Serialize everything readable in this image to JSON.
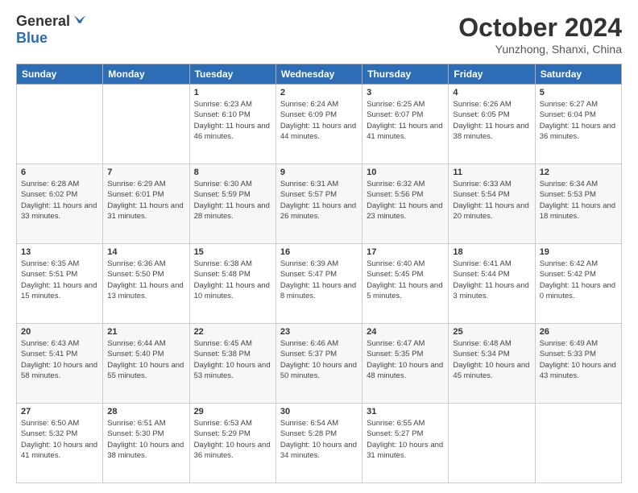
{
  "logo": {
    "general": "General",
    "blue": "Blue"
  },
  "header": {
    "title": "October 2024",
    "subtitle": "Yunzhong, Shanxi, China"
  },
  "weekdays": [
    "Sunday",
    "Monday",
    "Tuesday",
    "Wednesday",
    "Thursday",
    "Friday",
    "Saturday"
  ],
  "weeks": [
    [
      null,
      null,
      {
        "day": 1,
        "sunrise": "6:23 AM",
        "sunset": "6:10 PM",
        "daylight": "11 hours and 46 minutes."
      },
      {
        "day": 2,
        "sunrise": "6:24 AM",
        "sunset": "6:09 PM",
        "daylight": "11 hours and 44 minutes."
      },
      {
        "day": 3,
        "sunrise": "6:25 AM",
        "sunset": "6:07 PM",
        "daylight": "11 hours and 41 minutes."
      },
      {
        "day": 4,
        "sunrise": "6:26 AM",
        "sunset": "6:05 PM",
        "daylight": "11 hours and 38 minutes."
      },
      {
        "day": 5,
        "sunrise": "6:27 AM",
        "sunset": "6:04 PM",
        "daylight": "11 hours and 36 minutes."
      }
    ],
    [
      {
        "day": 6,
        "sunrise": "6:28 AM",
        "sunset": "6:02 PM",
        "daylight": "11 hours and 33 minutes."
      },
      {
        "day": 7,
        "sunrise": "6:29 AM",
        "sunset": "6:01 PM",
        "daylight": "11 hours and 31 minutes."
      },
      {
        "day": 8,
        "sunrise": "6:30 AM",
        "sunset": "5:59 PM",
        "daylight": "11 hours and 28 minutes."
      },
      {
        "day": 9,
        "sunrise": "6:31 AM",
        "sunset": "5:57 PM",
        "daylight": "11 hours and 26 minutes."
      },
      {
        "day": 10,
        "sunrise": "6:32 AM",
        "sunset": "5:56 PM",
        "daylight": "11 hours and 23 minutes."
      },
      {
        "day": 11,
        "sunrise": "6:33 AM",
        "sunset": "5:54 PM",
        "daylight": "11 hours and 20 minutes."
      },
      {
        "day": 12,
        "sunrise": "6:34 AM",
        "sunset": "5:53 PM",
        "daylight": "11 hours and 18 minutes."
      }
    ],
    [
      {
        "day": 13,
        "sunrise": "6:35 AM",
        "sunset": "5:51 PM",
        "daylight": "11 hours and 15 minutes."
      },
      {
        "day": 14,
        "sunrise": "6:36 AM",
        "sunset": "5:50 PM",
        "daylight": "11 hours and 13 minutes."
      },
      {
        "day": 15,
        "sunrise": "6:38 AM",
        "sunset": "5:48 PM",
        "daylight": "11 hours and 10 minutes."
      },
      {
        "day": 16,
        "sunrise": "6:39 AM",
        "sunset": "5:47 PM",
        "daylight": "11 hours and 8 minutes."
      },
      {
        "day": 17,
        "sunrise": "6:40 AM",
        "sunset": "5:45 PM",
        "daylight": "11 hours and 5 minutes."
      },
      {
        "day": 18,
        "sunrise": "6:41 AM",
        "sunset": "5:44 PM",
        "daylight": "11 hours and 3 minutes."
      },
      {
        "day": 19,
        "sunrise": "6:42 AM",
        "sunset": "5:42 PM",
        "daylight": "11 hours and 0 minutes."
      }
    ],
    [
      {
        "day": 20,
        "sunrise": "6:43 AM",
        "sunset": "5:41 PM",
        "daylight": "10 hours and 58 minutes."
      },
      {
        "day": 21,
        "sunrise": "6:44 AM",
        "sunset": "5:40 PM",
        "daylight": "10 hours and 55 minutes."
      },
      {
        "day": 22,
        "sunrise": "6:45 AM",
        "sunset": "5:38 PM",
        "daylight": "10 hours and 53 minutes."
      },
      {
        "day": 23,
        "sunrise": "6:46 AM",
        "sunset": "5:37 PM",
        "daylight": "10 hours and 50 minutes."
      },
      {
        "day": 24,
        "sunrise": "6:47 AM",
        "sunset": "5:35 PM",
        "daylight": "10 hours and 48 minutes."
      },
      {
        "day": 25,
        "sunrise": "6:48 AM",
        "sunset": "5:34 PM",
        "daylight": "10 hours and 45 minutes."
      },
      {
        "day": 26,
        "sunrise": "6:49 AM",
        "sunset": "5:33 PM",
        "daylight": "10 hours and 43 minutes."
      }
    ],
    [
      {
        "day": 27,
        "sunrise": "6:50 AM",
        "sunset": "5:32 PM",
        "daylight": "10 hours and 41 minutes."
      },
      {
        "day": 28,
        "sunrise": "6:51 AM",
        "sunset": "5:30 PM",
        "daylight": "10 hours and 38 minutes."
      },
      {
        "day": 29,
        "sunrise": "6:53 AM",
        "sunset": "5:29 PM",
        "daylight": "10 hours and 36 minutes."
      },
      {
        "day": 30,
        "sunrise": "6:54 AM",
        "sunset": "5:28 PM",
        "daylight": "10 hours and 34 minutes."
      },
      {
        "day": 31,
        "sunrise": "6:55 AM",
        "sunset": "5:27 PM",
        "daylight": "10 hours and 31 minutes."
      },
      null,
      null
    ]
  ]
}
